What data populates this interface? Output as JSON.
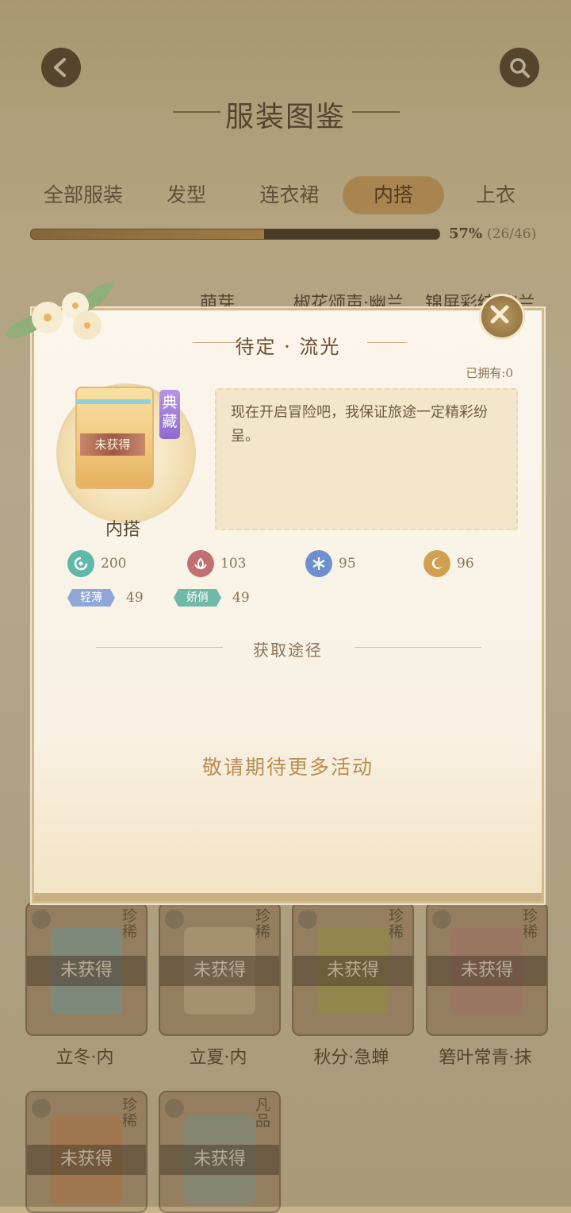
{
  "header": {
    "title": "服装图鉴"
  },
  "tabs": [
    {
      "label": "全部服装"
    },
    {
      "label": "发型"
    },
    {
      "label": "连衣裙"
    },
    {
      "label": "内搭",
      "active": true
    },
    {
      "label": "上衣"
    }
  ],
  "progress": {
    "percent_label": "57%",
    "count_label": "(26/46)",
    "fraction": 0.57
  },
  "grid": {
    "top_labels": [
      "萌芽",
      "椒花颂声·幽兰",
      "锦屏彩结·幽兰"
    ],
    "cards": [
      {
        "name": "立冬·内",
        "rarity": "珍稀",
        "status": "未获得"
      },
      {
        "name": "立夏·内",
        "rarity": "珍稀",
        "status": "未获得"
      },
      {
        "name": "秋分·急蝉",
        "rarity": "珍稀",
        "status": "未获得"
      },
      {
        "name": "箬叶常青·抹",
        "rarity": "珍稀",
        "status": "未获得"
      },
      {
        "name": "",
        "rarity": "珍稀",
        "status": "未获得"
      },
      {
        "name": "",
        "rarity": "凡品",
        "status": "未获得"
      }
    ]
  },
  "modal": {
    "title": "待定 · 流光",
    "owned": "已拥有:0",
    "item": {
      "status": "未获得",
      "badge": "典藏",
      "type": "内搭"
    },
    "description": "现在开启冒险吧，我保证旅途一定精彩纷呈。",
    "stats": [
      {
        "icon": "swirl-icon",
        "value": "200",
        "color": "#5fb8a8"
      },
      {
        "icon": "lotus-icon",
        "value": "103",
        "color": "#c07070"
      },
      {
        "icon": "snowflake-icon",
        "value": "95",
        "color": "#6f8fd0"
      },
      {
        "icon": "moon-icon",
        "value": "96",
        "color": "#d0a050"
      }
    ],
    "tags": [
      {
        "label": "轻薄",
        "value": "49",
        "color": "#8fa7d8"
      },
      {
        "label": "娇俏",
        "value": "49",
        "color": "#6fb9a6"
      }
    ],
    "source_title": "获取途径",
    "source_empty": "敬请期待更多活动"
  }
}
